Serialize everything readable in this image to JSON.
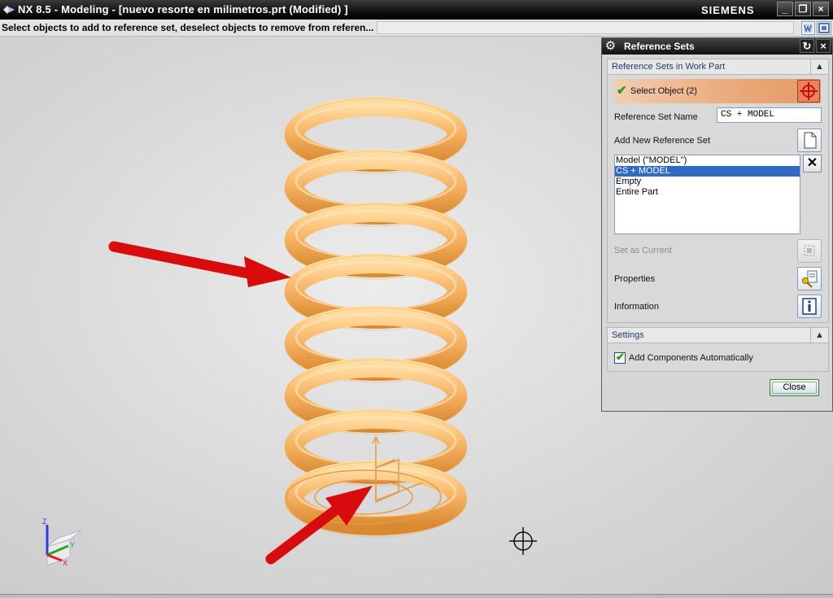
{
  "window": {
    "title": "NX 8.5 - Modeling - [nuevo resorte en milimetros.prt (Modified) ]",
    "brand": "SIEMENS",
    "controls": [
      "_",
      "❐",
      "×"
    ]
  },
  "cue_line": {
    "text": "Select objects to add to reference set, deselect objects to remove from referen..."
  },
  "viewport": {
    "spring_color": "#f5b060",
    "arrow_color": "#e01010",
    "triad_axes": {
      "z": "Z",
      "y": "Y",
      "x": "X"
    }
  },
  "dialog": {
    "title": "Reference Sets",
    "group_reference_sets": {
      "label": "Reference Sets in Work Part",
      "select_object": {
        "label": "Select Object (2)"
      },
      "ref_set_name_label": "Reference Set Name",
      "ref_set_name_value": "CS + MODEL",
      "add_new_label": "Add New Reference Set",
      "list_items": [
        "Model (\"MODEL\")",
        "CS + MODEL",
        "Empty",
        "Entire Part"
      ],
      "selected_item": "CS + MODEL",
      "set_as_current_label": "Set as Current",
      "properties_label": "Properties",
      "information_label": "Information"
    },
    "group_settings": {
      "label": "Settings",
      "add_components_label": "Add Components Automatically",
      "add_components_checked": true
    },
    "close_label": "Close"
  }
}
